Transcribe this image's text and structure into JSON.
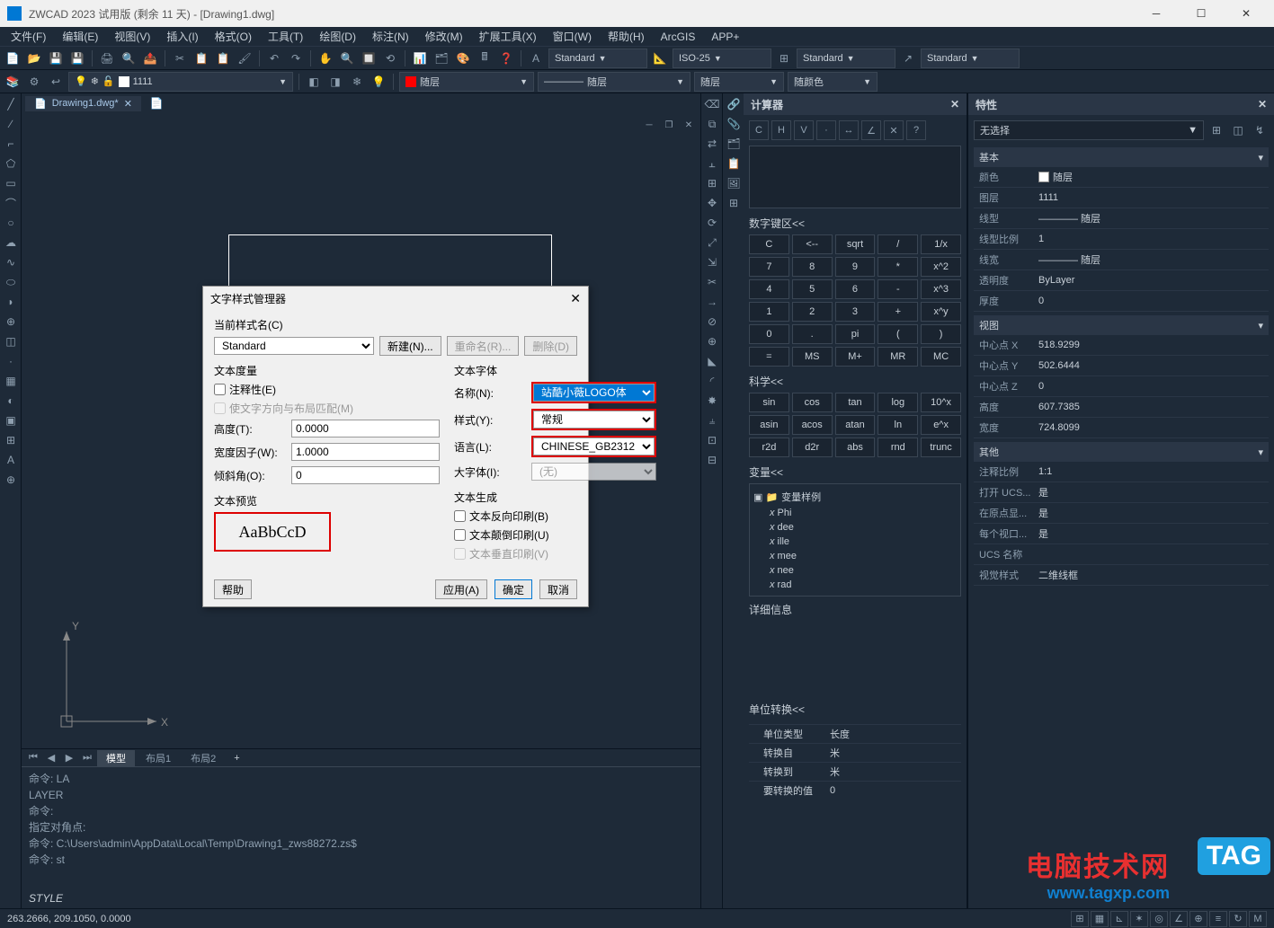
{
  "app": {
    "title": "ZWCAD 2023 试用版 (剩余 11 天) - [Drawing1.dwg]"
  },
  "menu": [
    "文件(F)",
    "编辑(E)",
    "视图(V)",
    "插入(I)",
    "格式(O)",
    "工具(T)",
    "绘图(D)",
    "标注(N)",
    "修改(M)",
    "扩展工具(X)",
    "窗口(W)",
    "帮助(H)",
    "ArcGIS",
    "APP+"
  ],
  "toolbar1": {
    "std_style": "Standard",
    "iso_style": "ISO-25",
    "sub_style": "Standard",
    "sub_style2": "Standard"
  },
  "toolbar2": {
    "layer_name": "1111",
    "layer_color": "随层",
    "linetype": "随层",
    "lineweight": "随层",
    "bycolor": "随颜色"
  },
  "doc_tab": {
    "name": "Drawing1.dwg*"
  },
  "bottom_tabs": {
    "model": "模型",
    "layout1": "布局1",
    "layout2": "布局2"
  },
  "cmd": {
    "history": "命令: LA\nLAYER\n命令:\n指定对角点:\n命令: C:\\Users\\admin\\AppData\\Local\\Temp\\Drawing1_zws88272.zs$\n命令: st",
    "current": "STYLE"
  },
  "status": {
    "coords": "263.2666, 209.1050, 0.0000"
  },
  "calc": {
    "title": "计算器",
    "numpad_title": "数字键区<<",
    "sci_title": "科学<<",
    "vars_title": "变量<<",
    "detail_title": "详细信息",
    "units_title": "单位转换<<",
    "keys_num": [
      "C",
      "<--",
      "sqrt",
      "/",
      "1/x",
      "7",
      "8",
      "9",
      "*",
      "x^2",
      "4",
      "5",
      "6",
      "-",
      "x^3",
      "1",
      "2",
      "3",
      "+",
      "x^y",
      "0",
      ".",
      "pi",
      "(",
      ")",
      "=",
      "MS",
      "M+",
      "MR",
      "MC"
    ],
    "keys_sci": [
      "sin",
      "cos",
      "tan",
      "log",
      "10^x",
      "asin",
      "acos",
      "atan",
      "ln",
      "e^x",
      "r2d",
      "d2r",
      "abs",
      "rnd",
      "trunc"
    ],
    "vars_root": "变量样例",
    "vars": [
      "Phi",
      "dee",
      "ille",
      "mee",
      "nee",
      "rad"
    ],
    "units": {
      "type_label": "单位类型",
      "type_value": "长度",
      "from_label": "转换自",
      "from_value": "米",
      "to_label": "转换到",
      "to_value": "米",
      "val_label": "要转换的值",
      "val_value": "0"
    }
  },
  "props": {
    "title": "特性",
    "sel": "无选择",
    "sections": {
      "basic": {
        "title": "基本",
        "items": [
          {
            "k": "颜色",
            "v": "随层",
            "sw": 1
          },
          {
            "k": "图层",
            "v": "1111"
          },
          {
            "k": "线型",
            "v": "———— 随层"
          },
          {
            "k": "线型比例",
            "v": "1"
          },
          {
            "k": "线宽",
            "v": "———— 随层"
          },
          {
            "k": "透明度",
            "v": "ByLayer"
          },
          {
            "k": "厚度",
            "v": "0"
          }
        ]
      },
      "view": {
        "title": "视图",
        "items": [
          {
            "k": "中心点 X",
            "v": "518.9299"
          },
          {
            "k": "中心点 Y",
            "v": "502.6444"
          },
          {
            "k": "中心点 Z",
            "v": "0"
          },
          {
            "k": "高度",
            "v": "607.7385"
          },
          {
            "k": "宽度",
            "v": "724.8099"
          }
        ]
      },
      "other": {
        "title": "其他",
        "items": [
          {
            "k": "注释比例",
            "v": "1:1"
          },
          {
            "k": "打开 UCS...",
            "v": "是"
          },
          {
            "k": "在原点显...",
            "v": "是"
          },
          {
            "k": "每个视口...",
            "v": "是"
          },
          {
            "k": "UCS 名称",
            "v": ""
          },
          {
            "k": "视觉样式",
            "v": "二维线框"
          }
        ]
      }
    }
  },
  "dialog": {
    "title": "文字样式管理器",
    "current_label": "当前样式名(C)",
    "current_value": "Standard",
    "btn_new": "新建(N)...",
    "btn_rename": "重命名(R)...",
    "btn_delete": "删除(D)",
    "grp_measure": "文本度量",
    "chk_annotative": "注释性(E)",
    "chk_match": "使文字方向与布局匹配(M)",
    "height_label": "高度(T):",
    "height_value": "0.0000",
    "width_label": "宽度因子(W):",
    "width_value": "1.0000",
    "oblique_label": "倾斜角(O):",
    "oblique_value": "0",
    "grp_font": "文本字体",
    "name_label": "名称(N):",
    "name_value": "站酷小薇LOGO体",
    "style_label": "样式(Y):",
    "style_value": "常规",
    "lang_label": "语言(L):",
    "lang_value": "CHINESE_GB2312",
    "big_label": "大字体(I):",
    "big_value": "(无)",
    "grp_preview": "文本预览",
    "preview_text": "AaBbCcD",
    "grp_gen": "文本生成",
    "chk_backward": "文本反向印刷(B)",
    "chk_upside": "文本颠倒印刷(U)",
    "chk_vertical": "文本垂直印刷(V)",
    "btn_help": "帮助",
    "btn_apply": "应用(A)",
    "btn_ok": "确定",
    "btn_cancel": "取消"
  },
  "watermark": {
    "line1": "电脑技术网",
    "line2": "www.tagxp.com",
    "tag": "TAG"
  }
}
